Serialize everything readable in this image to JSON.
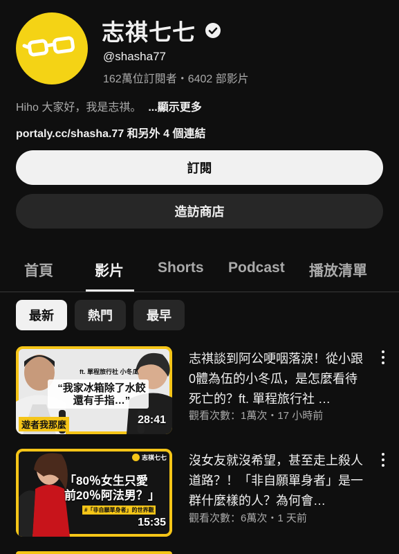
{
  "channel": {
    "name": "志祺七七",
    "handle": "@shasha77",
    "stats": "162萬位訂閱者・6402 部影片",
    "description": "Hiho 大家好，我是志祺。",
    "more_label": "...顯示更多",
    "links": "portaly.cc/shasha.77 和另外 4 個連結",
    "avatar_color": "#f4d315"
  },
  "buttons": {
    "subscribe": "訂閱",
    "shop": "造訪商店"
  },
  "tabs": [
    {
      "label": "首頁",
      "active": false
    },
    {
      "label": "影片",
      "active": true
    },
    {
      "label": "Shorts",
      "active": false
    },
    {
      "label": "Podcast",
      "active": false
    },
    {
      "label": "播放清單",
      "active": false
    }
  ],
  "chips": [
    {
      "label": "最新",
      "selected": true
    },
    {
      "label": "熱門",
      "selected": false
    },
    {
      "label": "最早",
      "selected": false
    }
  ],
  "videos": [
    {
      "title": "志祺談到阿公哽咽落淚！從小跟0體為伍的小冬瓜，是怎麼看待死亡的？ft. 單程旅行社 …",
      "meta": "觀看次數：1萬次・17 小時前",
      "duration": "28:41",
      "thumb_tag": "ft. 單程旅行社 小冬瓜",
      "thumb_quote_1": "“我家冰箱除了水餃",
      "thumb_quote_2": "還有手指…”",
      "thumb_corner": "遊者我那麼"
    },
    {
      "title": "沒女友就沒希望，甚至走上殺人道路？！「非自願單身者」是一群什麼樣的人？為何會…",
      "meta": "觀看次數：6萬次・1 天前",
      "duration": "15:35",
      "thumb_logo": "志祺七七",
      "thumb_line_1": "「80％女生只愛",
      "thumb_line_2": "前20％阿法男？」",
      "thumb_caption": "#「非自願單身者」的世界觀"
    }
  ]
}
